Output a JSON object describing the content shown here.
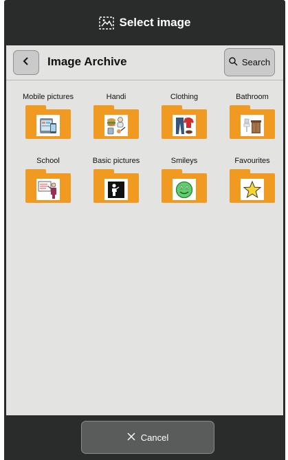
{
  "topbar": {
    "title": "Select image",
    "icon": "image-icon"
  },
  "header": {
    "back_icon": "chevron-left-icon",
    "title": "Image Archive",
    "search_label": "Search",
    "search_icon": "search-icon"
  },
  "folders": [
    {
      "label": "Mobile pictures",
      "icon": "mobile-devices-icon"
    },
    {
      "label": "Handi",
      "icon": "handi-objects-icon"
    },
    {
      "label": "Clothing",
      "icon": "clothing-icon"
    },
    {
      "label": "Bathroom",
      "icon": "bathroom-icon"
    },
    {
      "label": "School",
      "icon": "school-board-icon"
    },
    {
      "label": "Basic pictures",
      "icon": "person-symbol-icon"
    },
    {
      "label": "Smileys",
      "icon": "smiley-icon"
    },
    {
      "label": "Favourites",
      "icon": "star-icon"
    }
  ],
  "footer": {
    "cancel_label": "Cancel",
    "cancel_icon": "close-icon"
  },
  "colors": {
    "frame": "#2a2c2c",
    "panel": "#e3e3e1",
    "folder": "#f09a22",
    "button": "#c9cac9",
    "cancel_button": "#5a5b5b"
  }
}
